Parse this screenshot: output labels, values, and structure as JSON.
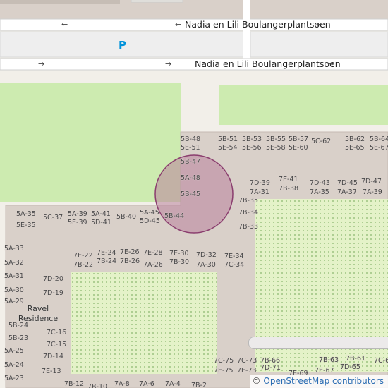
{
  "map": {
    "colors": {
      "background": "#f2efe9",
      "building": "#d9d0c9",
      "grass": "#cdebb0",
      "garden": "#e4f2c8",
      "road": "#ffffff",
      "parking": "#eeeeee",
      "highlight_fill": "#b9829d",
      "highlight_stroke": "#8a3d6e",
      "parking_icon": "#0092da"
    },
    "streets": [
      {
        "id": "top",
        "name": "Nadia en Lili Boulangerplantsoen",
        "direction": "west"
      },
      {
        "id": "bottom",
        "name": "Nadia en Lili Boulangerplantsoen",
        "direction": "east"
      }
    ],
    "arrows": {
      "west": "←",
      "east": "→"
    },
    "parking_label": "P",
    "place_name": "Ravel\nResidence",
    "place_line1": "Ravel",
    "place_line2": "Residence",
    "attribution": {
      "copyright": "©",
      "source": "OpenStreetMap contributors"
    },
    "building_labels": [
      "5B-48",
      "5E-51",
      "5B-51",
      "5E-54",
      "5B-53",
      "5E-56",
      "5B-55",
      "5E-58",
      "5B-57",
      "5E-60",
      "5C-62",
      "5B-62",
      "5E-65",
      "5B-64",
      "5E-67",
      "5B-47",
      "5A-48",
      "5B-45",
      "5B-44",
      "7D-39",
      "7A-31",
      "7E-41",
      "7B-38",
      "7D-43",
      "7A-35",
      "7D-45",
      "7A-37",
      "7D-47",
      "7A-39",
      "7B-35",
      "7B-34",
      "7B-33",
      "5A-35",
      "5E-35",
      "5C-37",
      "5A-39",
      "5E-39",
      "5A-41",
      "5D-41",
      "5B-40",
      "5A-45",
      "5D-45",
      "5A-33",
      "5A-32",
      "5A-31",
      "5A-30",
      "5A-29",
      "5B-24",
      "5B-23",
      "5A-25",
      "5A-24",
      "5A-23",
      "7D-20",
      "7D-19",
      "7C-16",
      "7C-15",
      "7D-14",
      "7E-13",
      "7B-12",
      "7B-10",
      "7A-8",
      "7A-6",
      "7A-4",
      "7B-2",
      "7E-22",
      "7B-22",
      "7E-24",
      "7B-24",
      "7E-26",
      "7B-26",
      "7E-28",
      "7A-26",
      "7E-30",
      "7B-30",
      "7D-32",
      "7A-30",
      "7E-34",
      "7C-34",
      "7C-75",
      "7E-75",
      "7C-73",
      "7E-73",
      "7B-66",
      "7D-71",
      "7E-69",
      "7E-67",
      "7B-63",
      "7B-61",
      "7D-65",
      "7C-6"
    ]
  }
}
